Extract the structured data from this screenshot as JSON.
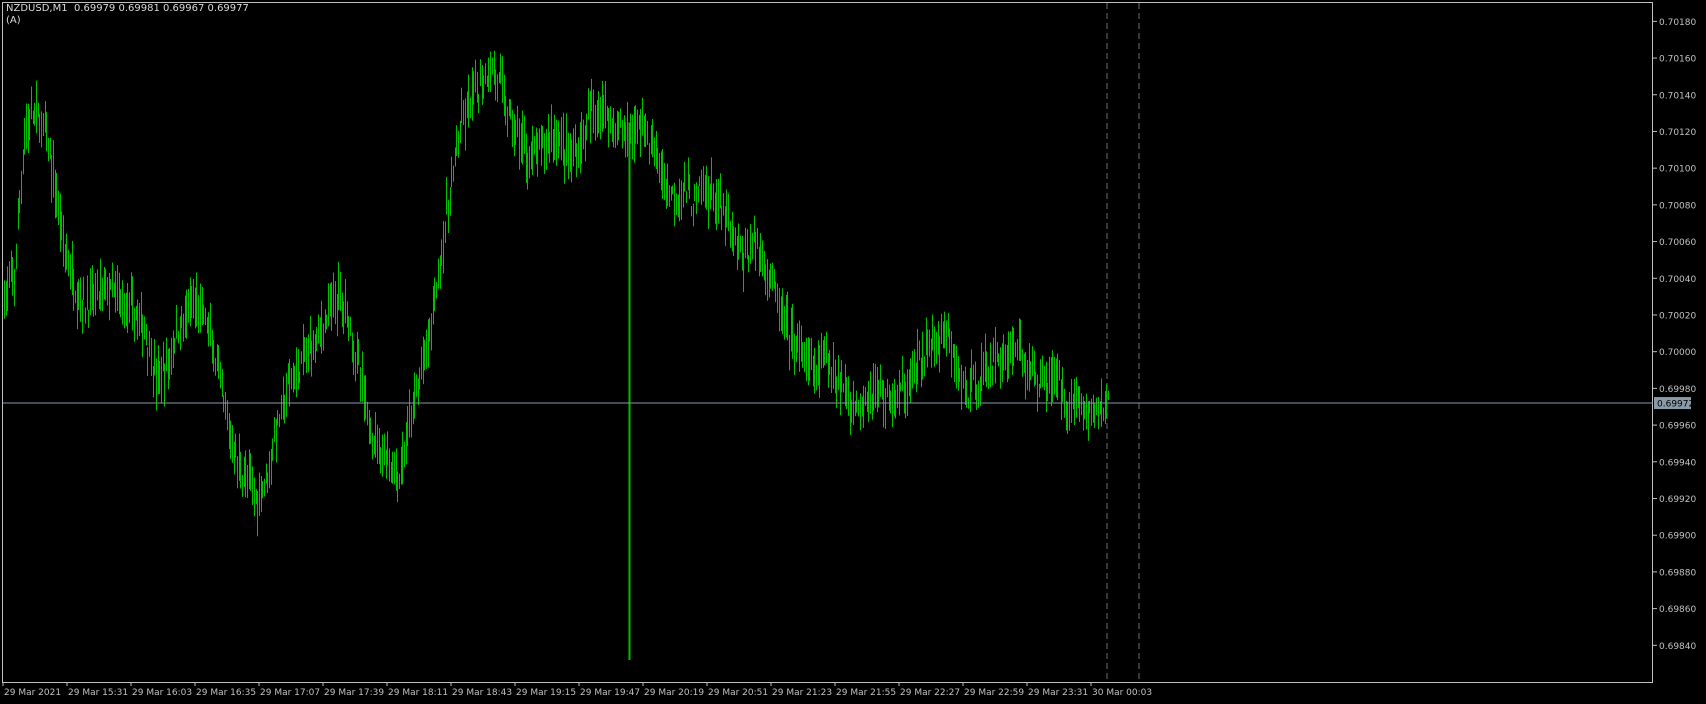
{
  "header": {
    "symbol_timeframe": "NZDUSD,M1",
    "ohlc": "0.69979 0.69981 0.69967 0.69977",
    "ea_label": "(A)"
  },
  "colors": {
    "background": "#000000",
    "bars": "#00c000",
    "frame": "#c0c0c0",
    "axis_text": "#c0c0c0",
    "bid_line": "#8a9aa8",
    "bid_label_bg": "#8a9aa8",
    "period_separator": "#6e6e6e"
  },
  "chart_data": {
    "type": "ohlc-bars",
    "symbol": "NZDUSD",
    "timeframe": "M1",
    "ylim": [
      0.6982,
      0.7019
    ],
    "y_ticks": [
      "0.70180",
      "0.70160",
      "0.70140",
      "0.70120",
      "0.70100",
      "0.70080",
      "0.70060",
      "0.70040",
      "0.70020",
      "0.70000",
      "0.69980",
      "0.69960",
      "0.69940",
      "0.69920",
      "0.69900",
      "0.69880",
      "0.69860",
      "0.69840"
    ],
    "x_ticks": [
      "29 Mar 2021",
      "29 Mar 15:31",
      "29 Mar 16:03",
      "29 Mar 16:35",
      "29 Mar 17:07",
      "29 Mar 17:39",
      "29 Mar 18:11",
      "29 Mar 18:43",
      "29 Mar 19:15",
      "29 Mar 19:47",
      "29 Mar 20:19",
      "29 Mar 20:51",
      "29 Mar 21:23",
      "29 Mar 21:55",
      "29 Mar 22:27",
      "29 Mar 22:59",
      "29 Mar 23:31",
      "30 Mar 00:03"
    ],
    "current_bid": "0.69972",
    "path": [
      [
        0,
        0.7003
      ],
      [
        6,
        0.7004
      ],
      [
        12,
        0.7012
      ],
      [
        18,
        0.7013
      ],
      [
        24,
        0.7012
      ],
      [
        30,
        0.7009
      ],
      [
        36,
        0.70055
      ],
      [
        42,
        0.70035
      ],
      [
        48,
        0.70025
      ],
      [
        54,
        0.7003
      ],
      [
        60,
        0.70035
      ],
      [
        66,
        0.7003
      ],
      [
        72,
        0.70025
      ],
      [
        78,
        0.7002
      ],
      [
        84,
        0.7001
      ],
      [
        90,
        0.69985
      ],
      [
        96,
        0.6999
      ],
      [
        102,
        0.7001
      ],
      [
        108,
        0.7002
      ],
      [
        114,
        0.70025
      ],
      [
        120,
        0.70015
      ],
      [
        126,
        0.6999
      ],
      [
        132,
        0.6996
      ],
      [
        138,
        0.6994
      ],
      [
        144,
        0.6993
      ],
      [
        150,
        0.6992
      ],
      [
        156,
        0.69935
      ],
      [
        162,
        0.6996
      ],
      [
        168,
        0.6998
      ],
      [
        174,
        0.6999
      ],
      [
        180,
        0.7
      ],
      [
        186,
        0.7001
      ],
      [
        192,
        0.7002
      ],
      [
        198,
        0.7003
      ],
      [
        204,
        0.7002
      ],
      [
        210,
        0.6999
      ],
      [
        216,
        0.6996
      ],
      [
        222,
        0.6995
      ],
      [
        228,
        0.6994
      ],
      [
        234,
        0.6993
      ],
      [
        240,
        0.6996
      ],
      [
        246,
        0.69985
      ],
      [
        252,
        0.7001
      ],
      [
        258,
        0.7005
      ],
      [
        264,
        0.70085
      ],
      [
        270,
        0.7012
      ],
      [
        276,
        0.70135
      ],
      [
        282,
        0.70145
      ],
      [
        288,
        0.70155
      ],
      [
        294,
        0.70145
      ],
      [
        300,
        0.70125
      ],
      [
        306,
        0.70115
      ],
      [
        312,
        0.70105
      ],
      [
        318,
        0.7011
      ],
      [
        324,
        0.7012
      ],
      [
        330,
        0.70115
      ],
      [
        336,
        0.70105
      ],
      [
        342,
        0.70115
      ],
      [
        348,
        0.7013
      ],
      [
        354,
        0.70135
      ],
      [
        360,
        0.70125
      ],
      [
        366,
        0.7012
      ],
      [
        372,
        0.7012
      ],
      [
        378,
        0.70125
      ],
      [
        384,
        0.7011
      ],
      [
        390,
        0.70095
      ],
      [
        396,
        0.70085
      ],
      [
        402,
        0.7009
      ],
      [
        408,
        0.7008
      ],
      [
        414,
        0.7009
      ],
      [
        420,
        0.70085
      ],
      [
        426,
        0.70075
      ],
      [
        432,
        0.7006
      ],
      [
        438,
        0.7005
      ],
      [
        444,
        0.7006
      ],
      [
        450,
        0.7005
      ],
      [
        456,
        0.70035
      ],
      [
        462,
        0.70015
      ],
      [
        468,
        0.70005
      ],
      [
        474,
        0.69995
      ],
      [
        480,
        0.6999
      ],
      [
        486,
        0.69995
      ],
      [
        492,
        0.6999
      ],
      [
        498,
        0.6998
      ],
      [
        504,
        0.6997
      ],
      [
        510,
        0.69975
      ],
      [
        516,
        0.6998
      ],
      [
        522,
        0.69975
      ],
      [
        528,
        0.69975
      ],
      [
        534,
        0.6998
      ],
      [
        540,
        0.6999
      ],
      [
        546,
        0.7
      ],
      [
        552,
        0.70005
      ],
      [
        558,
        0.7001
      ],
      [
        564,
        0.6999
      ],
      [
        570,
        0.69975
      ],
      [
        576,
        0.69985
      ],
      [
        582,
        0.6999
      ],
      [
        588,
        0.69995
      ],
      [
        594,
        0.7
      ],
      [
        600,
        0.70005
      ],
      [
        606,
        0.6999
      ],
      [
        612,
        0.69985
      ],
      [
        618,
        0.69985
      ],
      [
        624,
        0.69985
      ],
      [
        630,
        0.6997
      ],
      [
        636,
        0.69975
      ],
      [
        642,
        0.69965
      ],
      [
        648,
        0.6997
      ],
      [
        654,
        0.69972
      ]
    ],
    "bars_omitted_note": null
  }
}
